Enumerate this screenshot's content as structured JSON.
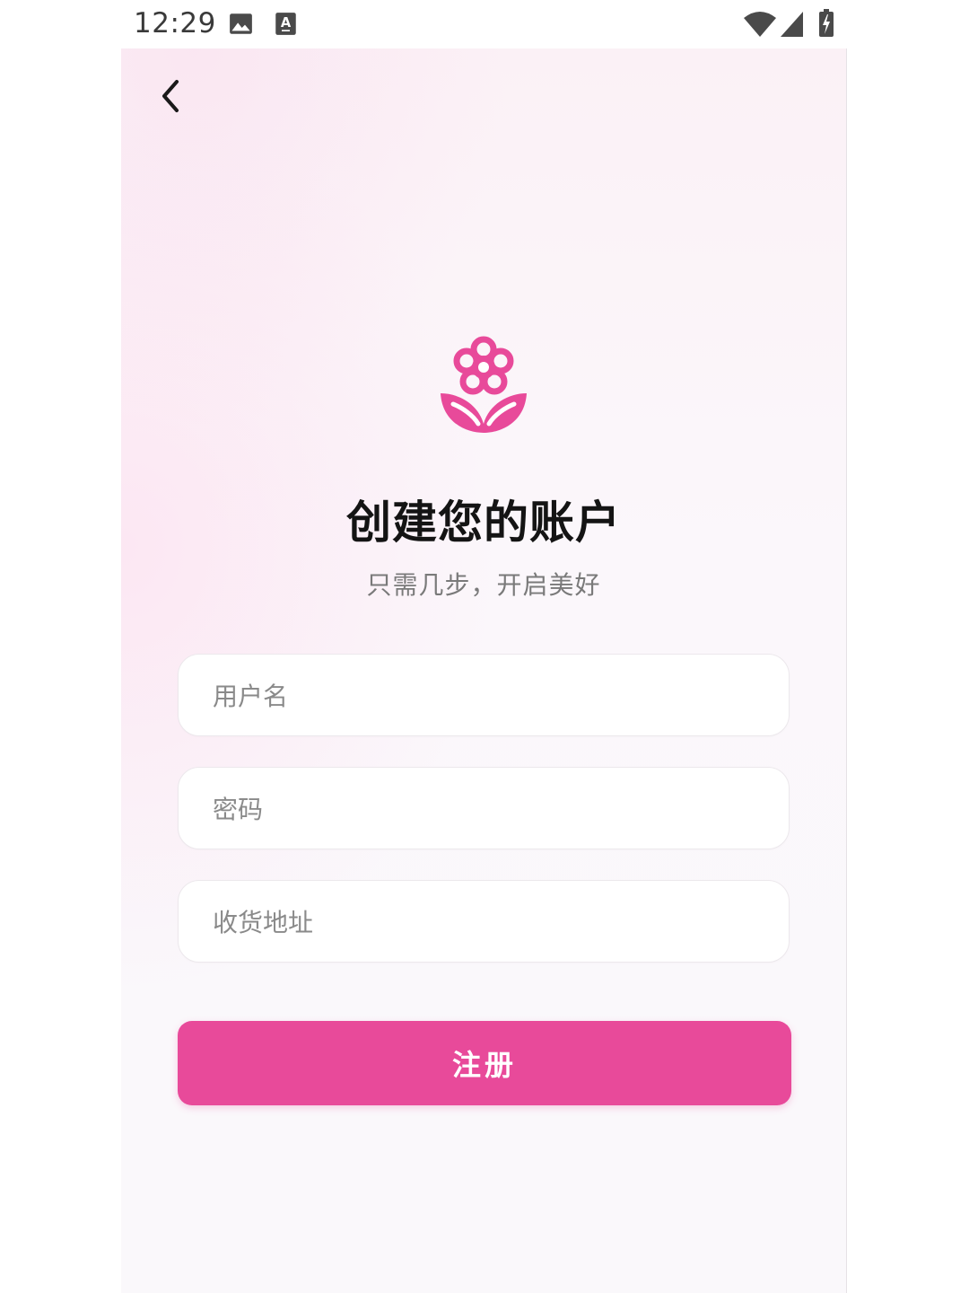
{
  "status_bar": {
    "time": "12:29",
    "icons": [
      "image-icon",
      "text-a-icon",
      "wifi-icon",
      "signal-icon",
      "battery-charging-icon"
    ]
  },
  "nav": {
    "back_icon": "chevron-left-icon"
  },
  "header": {
    "logo_icon": "flower-icon",
    "title": "创建您的账户",
    "subtitle": "只需几步，开启美好"
  },
  "form": {
    "username_placeholder": "用户名",
    "username_value": "",
    "password_placeholder": "密码",
    "password_value": "",
    "address_placeholder": "收货地址",
    "address_value": "",
    "submit_label": "注册"
  },
  "colors": {
    "accent": "#e84a9a",
    "title_text": "#141414",
    "subtitle_text": "#7a7a7a"
  }
}
